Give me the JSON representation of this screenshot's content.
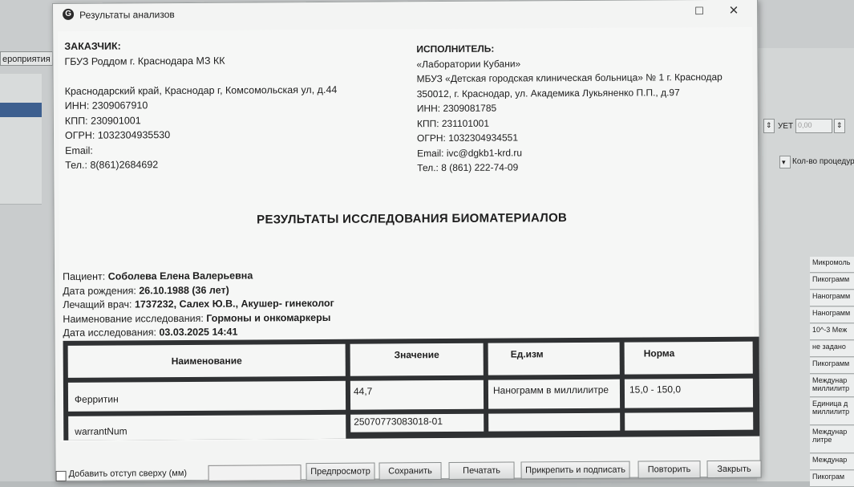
{
  "background": {
    "tab_label": "ероприятия",
    "right_labels": {
      "uet": "УЕТ",
      "uet_value": "0,00",
      "qty": "Кол-во процедур"
    },
    "units_column": [
      "Микромоль",
      "Пикограмм",
      "Нанограмм",
      "Нанограмм",
      "10^-3 Меж",
      "не задано",
      "Пикограмм",
      "Междунар миллилитр",
      "Единица д миллилитр",
      "Междунар литре",
      "Междунар",
      "Пикограм"
    ]
  },
  "window": {
    "title": "Результаты анализов",
    "icon": "app-logo-icon",
    "controls": {
      "maximize": "☐",
      "close": "✕"
    }
  },
  "customer": {
    "label": "ЗАКАЗЧИК:",
    "name": "ГБУЗ Роддом г. Краснодара МЗ КК",
    "address": "Краснодарский край, Краснодар г, Комсомольская ул, д.44",
    "inn": "ИНН: 2309067910",
    "kpp": "КПП: 230901001",
    "ogrn": "ОГРН: 1032304935530",
    "email": "Email:",
    "phone": "Тел.: 8(861)2684692"
  },
  "executor": {
    "label": "ИСПОЛНИТЕЛЬ:",
    "lab": "«Лаборатории Кубани»",
    "org": "МБУЗ «Детская городская клиническая больница» № 1 г. Краснодар",
    "address": "350012, г. Краснодар, ул. Академика Лукьяненко П.П., д.97",
    "inn": "ИНН: 2309081785",
    "kpp": "КПП: 231101001",
    "ogrn": "ОГРН: 1032304934551",
    "email": "Email: ivc@dgkb1-krd.ru",
    "phone": "Тел.: 8 (861) 222-74-09"
  },
  "document_title": "РЕЗУЛЬТАТЫ ИССЛЕДОВАНИЯ БИОМАТЕРИАЛОВ",
  "patient": {
    "patient_label": "Пациент: ",
    "patient_value": "Соболева Елена Валерьевна",
    "birth_label": "Дата рождения: ",
    "birth_value": "26.10.1988 (36 лет)",
    "doctor_label": "Лечащий врач: ",
    "doctor_value": "1737232, Салех Ю.В., Акушер- гинеколог",
    "study_label": "Наименование исследования: ",
    "study_value": "Гормоны и онкомаркеры",
    "date_label": "Дата исследования: ",
    "date_value": "03.03.2025 14:41"
  },
  "results": {
    "headers": [
      "Наименование",
      "Значение",
      "Ед.изм",
      "Норма"
    ],
    "rows": [
      [
        "Ферритин",
        "44,7",
        "Нанограмм в миллилитре",
        "15,0 - 150,0"
      ],
      [
        "warrantNum",
        "25070773083018-01",
        "",
        ""
      ]
    ]
  },
  "footer": {
    "indent_label": "Добавить отступ сверху (мм)",
    "buttons": [
      "Предпросмотр",
      "Сохранить",
      "Печатать",
      "Прикрепить и подписать",
      "Повторить",
      "Закрыть"
    ]
  }
}
